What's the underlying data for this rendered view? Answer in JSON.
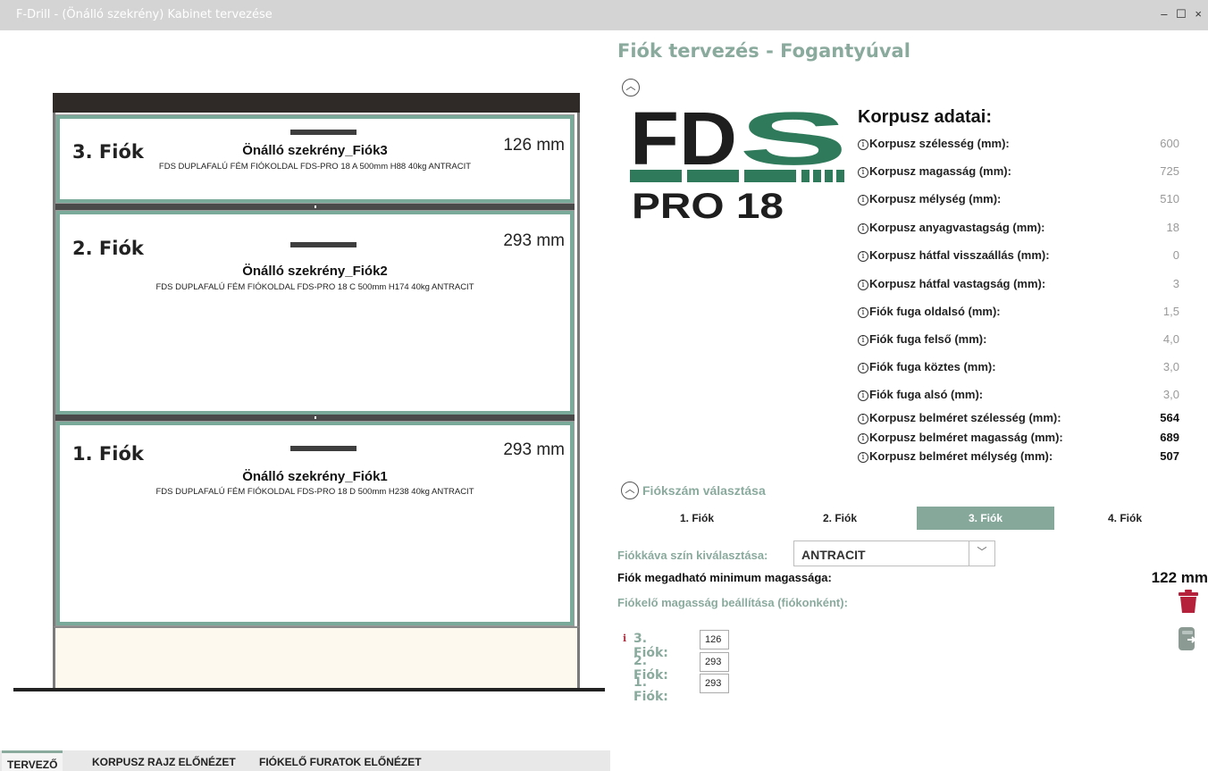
{
  "window": {
    "title": "F-Drill - (Önálló szekrény) Kabinet tervezése",
    "controls": "–  ☐  ×"
  },
  "drawers_preview": [
    {
      "name": "3. Fiók",
      "height": "126 mm",
      "title": "Önálló szekrény_Fiók3",
      "spec": "FDS DUPLAFALÚ FÉM FIÓKOLDAL FDS-PRO 18 A 500mm H88 40kg ANTRACIT"
    },
    {
      "name": "2. Fiók",
      "height": "293 mm",
      "title": "Önálló szekrény_Fiók2",
      "spec": "FDS DUPLAFALÚ FÉM FIÓKOLDAL FDS-PRO 18 C 500mm H174 40kg ANTRACIT"
    },
    {
      "name": "1. Fiók",
      "height": "293 mm",
      "title": "Önálló szekrény_Fiók1",
      "spec": "FDS DUPLAFALÚ FÉM FIÓKOLDAL FDS-PRO 18 D 500mm H238 40kg ANTRACIT"
    }
  ],
  "bottom_tabs": [
    "TERVEZŐ",
    "KORPUSZ RAJZ ELŐNÉZET",
    "FIÓKELŐ FURATOK ELŐNÉZET"
  ],
  "panel": {
    "title": "Fiók tervezés - Fogantyúval",
    "logo_text": {
      "top": "FDS",
      "bottom": "PRO 18"
    },
    "korpusz_title": "Korpusz adatai:",
    "korpusz_rows": [
      {
        "label": "Korpusz szélesség (mm):",
        "value": "600"
      },
      {
        "label": "Korpusz magasság (mm):",
        "value": "725"
      },
      {
        "label": "Korpusz mélység (mm):",
        "value": "510"
      },
      {
        "label": "Korpusz anyagvastagság (mm):",
        "value": "18"
      },
      {
        "label": "Korpusz hátfal visszaállás (mm):",
        "value": "0"
      },
      {
        "label": "Korpusz hátfal vastagság (mm):",
        "value": "3"
      },
      {
        "label": "Fiók fuga oldalsó (mm):",
        "value": "1,5"
      },
      {
        "label": "Fiók fuga felső (mm):",
        "value": "4,0"
      },
      {
        "label": "Fiók fuga köztes (mm):",
        "value": "3,0"
      },
      {
        "label": "Fiók fuga alsó (mm):",
        "value": "3,0"
      },
      {
        "label": "Korpusz belméret szélesség (mm):",
        "value": "564"
      },
      {
        "label": "Korpusz belméret magasság (mm):",
        "value": "689"
      },
      {
        "label": "Korpusz belméret mélység (mm):",
        "value": "507"
      }
    ],
    "count_title": "Fiókszám választása",
    "count_tabs": [
      "1. Fiók",
      "2. Fiók",
      "3. Fiók",
      "4. Fiók"
    ],
    "active_count_tab": "3. Fiók",
    "color_label": "Fiókkáva szín kiválasztása:",
    "color_value": "ANTRACIT",
    "min_label": "Fiók megadható minimum magassága:",
    "min_value": "122 mm",
    "height_label": "Fiókelő magasság beállítása (fiókonként):",
    "height_rows": [
      {
        "label": "3. Fiók:",
        "value": "126"
      },
      {
        "label": "2. Fiók:",
        "value": "293"
      },
      {
        "label": "1. Fiók:",
        "value": "293"
      }
    ]
  },
  "colors": {
    "accent": "#86a89b",
    "trash": "#b5203a"
  }
}
